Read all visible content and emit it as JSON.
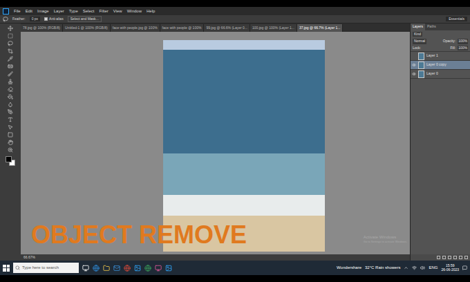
{
  "menu": [
    "File",
    "Edit",
    "Image",
    "Layer",
    "Type",
    "Select",
    "Filter",
    "View",
    "Window",
    "Help"
  ],
  "options": {
    "feather_label": "Feather:",
    "feather_value": "0 px",
    "anti_alias": "Anti-alias",
    "anti_alias_checked": true,
    "button": "Select and Mask..."
  },
  "workspace": "Essentials",
  "tabs": [
    {
      "label": "78.jpg @ 100% (RGB/8)",
      "selected": false
    },
    {
      "label": "Untitled-1 @ 100% (RGB/8)",
      "selected": false
    },
    {
      "label": "face with people.jpg @ 100%",
      "selected": false
    },
    {
      "label": "face with people @ 100%",
      "selected": false
    },
    {
      "label": "99.jpg @ 66.6% (Layer 0...",
      "selected": false
    },
    {
      "label": "100.jpg @ 100% (Layer 1...",
      "selected": false
    },
    {
      "label": "37.jpg @ 66.7% (Layer 1...",
      "selected": true
    }
  ],
  "layers_panel": {
    "tabs": [
      {
        "label": "Layers",
        "selected": true
      },
      {
        "label": "Paths",
        "selected": false
      }
    ],
    "kind": "Kind",
    "blend": "Normal",
    "opacity_label": "Opacity:",
    "opacity": "100%",
    "lock_label": "Lock:",
    "fill_label": "Fill:",
    "fill": "100%",
    "layers": [
      {
        "name": "Layer 1",
        "selected": false,
        "visible": false
      },
      {
        "name": "Layer 0 copy",
        "selected": true,
        "visible": true
      },
      {
        "name": "Layer 0",
        "selected": false,
        "visible": true
      }
    ]
  },
  "status": {
    "zoom": "66.67%"
  },
  "overlay": "OBJECT REMOVE",
  "watermark": {
    "title": "Activate Windows",
    "subtitle": "Go to Settings to activate Windows."
  },
  "taskbar": {
    "search": "Type here to search",
    "tray_app": "Wondershare",
    "weather": "32°C  Rain showers",
    "language": "ENG",
    "time": "15:59",
    "date": "26-06-2023"
  }
}
